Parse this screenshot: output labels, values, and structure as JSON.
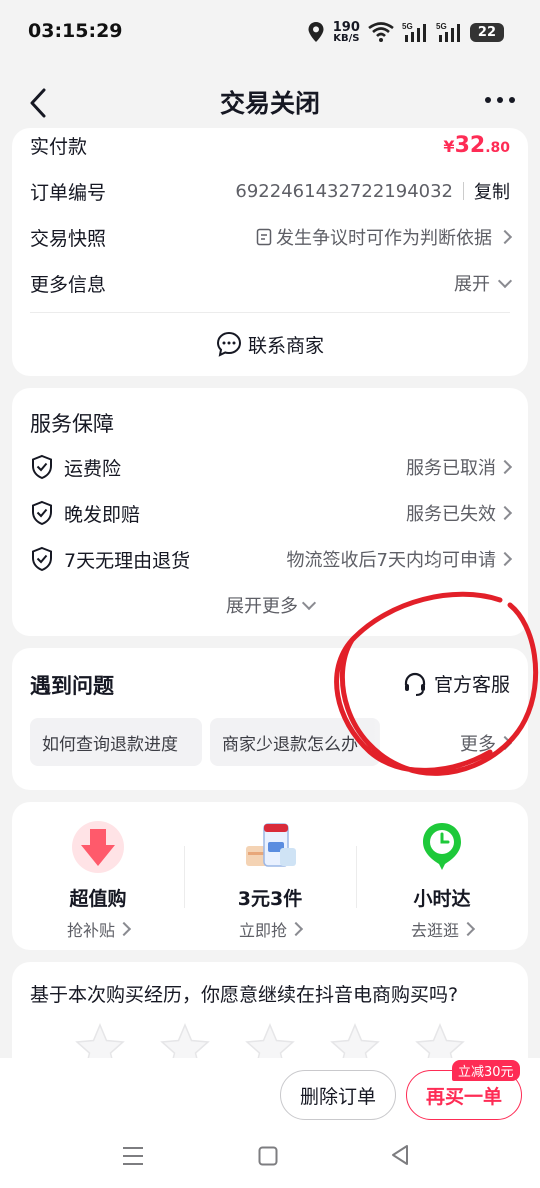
{
  "status": {
    "time": "03:15:29",
    "speed_value": "190",
    "speed_unit": "KB/S",
    "net1": "5G",
    "net2": "5G",
    "battery": "22"
  },
  "nav": {
    "title": "交易关闭"
  },
  "order": {
    "paid_label": "实付款",
    "paid_symbol": "¥",
    "paid_int": "32",
    "paid_dec": ".80",
    "order_no_label": "订单编号",
    "order_no": "6922461432722194032",
    "copy_label": "复制",
    "snapshot_label": "交易快照",
    "snapshot_value": "发生争议时可作为判断依据",
    "more_info_label": "更多信息",
    "more_info_value": "展开",
    "contact_label": "联系商家"
  },
  "service": {
    "title": "服务保障",
    "items": [
      {
        "label": "运费险",
        "status": "服务已取消"
      },
      {
        "label": "晚发即赔",
        "status": "服务已失效"
      },
      {
        "label": "7天无理由退货",
        "status": "物流签收后7天内均可申请"
      }
    ],
    "expand_label": "展开更多"
  },
  "issues": {
    "title": "遇到问题",
    "official_label": "官方客服",
    "chips": [
      "如何查询退款进度",
      "商家少退款怎么办"
    ],
    "more_label": "更多"
  },
  "promos": [
    {
      "name": "超值购",
      "sub": "抢补贴"
    },
    {
      "name": "3元3件",
      "sub": "立即抢"
    },
    {
      "name": "小时达",
      "sub": "去逛逛"
    }
  ],
  "survey": {
    "question": "基于本次购买经历，你愿意继续在抖音电商购买吗?"
  },
  "actions": {
    "delete_label": "删除订单",
    "rebuy_label": "再买一单",
    "rebuy_badge": "立减30元"
  },
  "colors": {
    "accent": "#fe2c55",
    "annotation": "#e0141e",
    "green": "#1ec93a"
  }
}
